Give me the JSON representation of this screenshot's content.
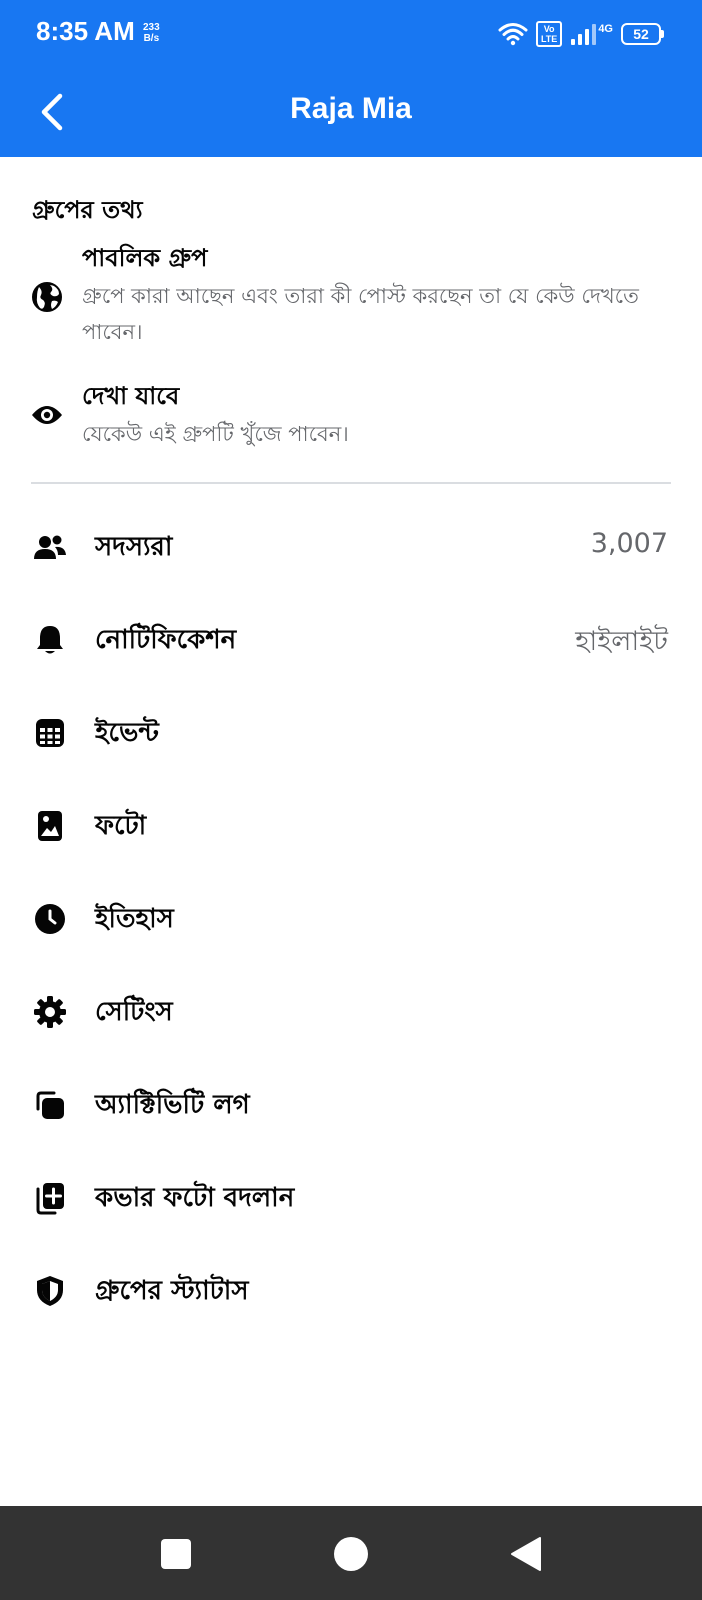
{
  "status_bar": {
    "time": "8:35 AM",
    "speed_value": "233",
    "speed_unit": "B/s",
    "volte_top": "Vo",
    "volte_bottom": "LTE",
    "network": "4G",
    "battery": "52"
  },
  "app_bar": {
    "title": "Raja Mia",
    "back_icon": "chevron-left-icon"
  },
  "group_info": {
    "heading": "গ্রুপের তথ্য",
    "items": [
      {
        "icon": "globe-icon",
        "title": "পাবলিক গ্রুপ",
        "description": "গ্রুপে কারা আছেন এবং তারা কী পোস্ট করছেন তা যে কেউ দেখতে পাবেন।"
      },
      {
        "icon": "eye-icon",
        "title": "দেখা যাবে",
        "description": "যেকেউ এই গ্রুপটি খুঁজে পাবেন।"
      }
    ]
  },
  "menu": [
    {
      "icon": "members-icon",
      "label": "সদস্যরা",
      "value": "3,007"
    },
    {
      "icon": "bell-icon",
      "label": "নোটিফিকেশন",
      "value": "হাইলাইট"
    },
    {
      "icon": "calendar-icon",
      "label": "ইভেন্ট",
      "value": ""
    },
    {
      "icon": "photo-icon",
      "label": "ফটো",
      "value": ""
    },
    {
      "icon": "clock-icon",
      "label": "ইতিহাস",
      "value": ""
    },
    {
      "icon": "gear-icon",
      "label": "সেটিংস",
      "value": ""
    },
    {
      "icon": "activity-log-icon",
      "label": "অ্যাক্টিভিটি লগ",
      "value": ""
    },
    {
      "icon": "add-cover-photo-icon",
      "label": "কভার ফটো বদলান",
      "value": ""
    },
    {
      "icon": "shield-icon",
      "label": "গ্রুপের স্ট্যাটাস",
      "value": ""
    }
  ],
  "nav_bar": {
    "icons": [
      "recent-apps-icon",
      "home-icon",
      "back-icon"
    ]
  },
  "colors": {
    "brand": "#1877f2",
    "text_primary": "#050505",
    "text_secondary": "#65676b",
    "divider": "#dadde1",
    "nav_background": "#333333"
  }
}
